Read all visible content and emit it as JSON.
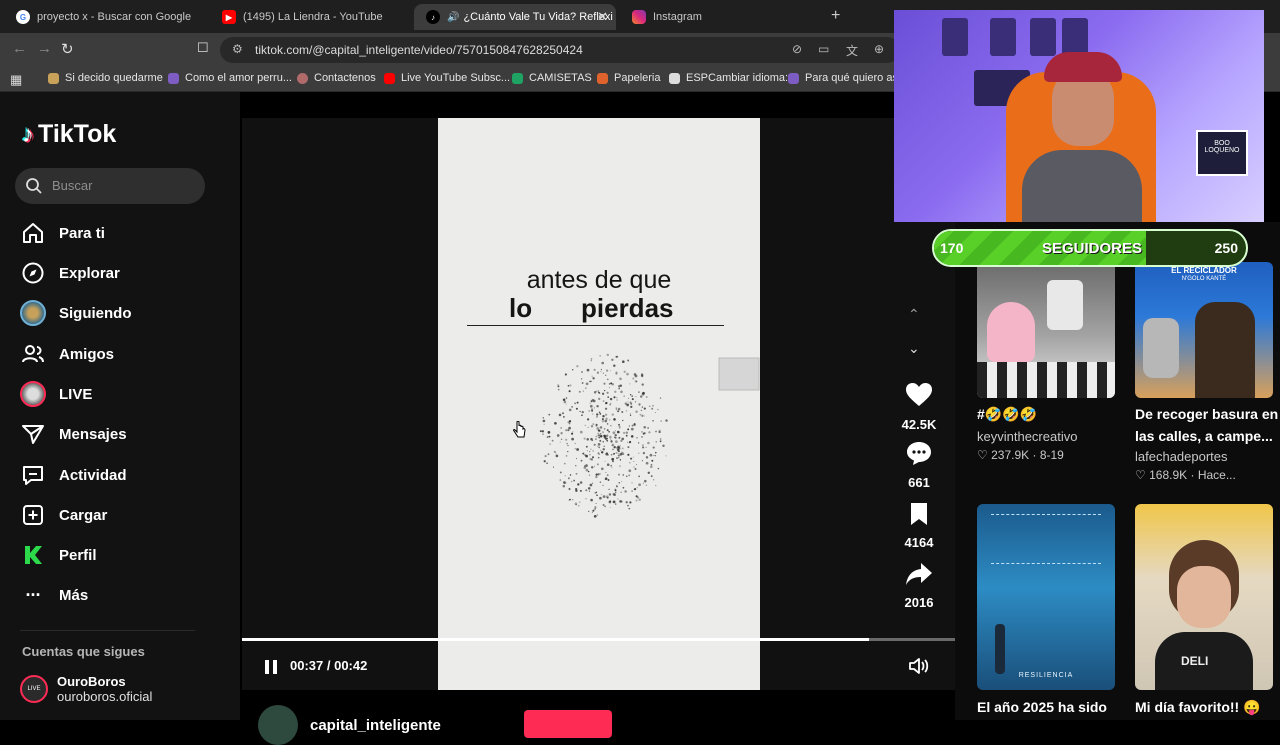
{
  "browser": {
    "tabs": [
      {
        "title": "proyecto x - Buscar con Google",
        "favicon": "google-icon"
      },
      {
        "title": "(1495) La Liendra - YouTube",
        "favicon": "youtube-icon"
      },
      {
        "title": "¿Cuánto Vale Tu Vida? Reflexi",
        "favicon": "tiktok-icon",
        "active": true
      },
      {
        "title": "Instagram",
        "favicon": "instagram-icon"
      }
    ],
    "url": "tiktok.com/@capital_inteligente/video/7570150847628250424",
    "bookmarks": [
      "Si decido quedarme",
      "Como el amor perru...",
      "Contactenos",
      "Live YouTube Subsc...",
      "CAMISETAS",
      "Papeleria",
      "ESPCambiar idioma:",
      "Para qué quiero asp"
    ]
  },
  "sidebar": {
    "logo": "TikTok",
    "search_placeholder": "Buscar",
    "nav": [
      {
        "label": "Para ti",
        "icon": "home-icon"
      },
      {
        "label": "Explorar",
        "icon": "compass-icon"
      },
      {
        "label": "Siguiendo",
        "icon": "following-avatar"
      },
      {
        "label": "Amigos",
        "icon": "friends-icon"
      },
      {
        "label": "LIVE",
        "icon": "live-avatar"
      },
      {
        "label": "Mensajes",
        "icon": "send-icon"
      },
      {
        "label": "Actividad",
        "icon": "activity-icon"
      },
      {
        "label": "Cargar",
        "icon": "upload-icon"
      },
      {
        "label": "Perfil",
        "icon": "profile-icon"
      },
      {
        "label": "Más",
        "icon": "more-icon"
      }
    ],
    "following_title": "Cuentas que sigues",
    "following": [
      {
        "name": "OuroBoros",
        "handle": "ouroboros.oficial"
      }
    ]
  },
  "video": {
    "overlay_line1": "antes de que",
    "overlay_line2a": "lo",
    "overlay_line2b": "pierdas",
    "time": "00:37 / 00:42",
    "progress": 0.88,
    "author": "capital_inteligente",
    "likes": "42.5K",
    "comments": "661",
    "saves": "4164",
    "shares": "2016"
  },
  "recommendations": [
    {
      "title": "#🤣🤣🤣",
      "author": "keyvinthecreativo",
      "likes": "237.9K",
      "date": "8-19"
    },
    {
      "title": "De recoger basura en las calles, a campe...",
      "author": "lafechadeportes",
      "likes": "168.9K",
      "date": "Hace..."
    },
    {
      "title": "El año 2025 ha sido",
      "thumb_text": "RESILIENCIA"
    },
    {
      "title": "Mi día favorito!! 😛",
      "thumb_text": "DELI"
    }
  ],
  "thumb_labels": {
    "rec2": "EL RECICLADOR",
    "rec2_sub": "N'GOLO KANTÉ"
  },
  "stream_overlay": {
    "followers_label": "SEGUIDORES",
    "current": "170",
    "goal": "250",
    "progress": 0.68,
    "sign_text": "BOO LOQUENO"
  },
  "colors": {
    "accent": "#fe2c55",
    "teal": "#25f4ee",
    "progress_green": "#58d028"
  }
}
